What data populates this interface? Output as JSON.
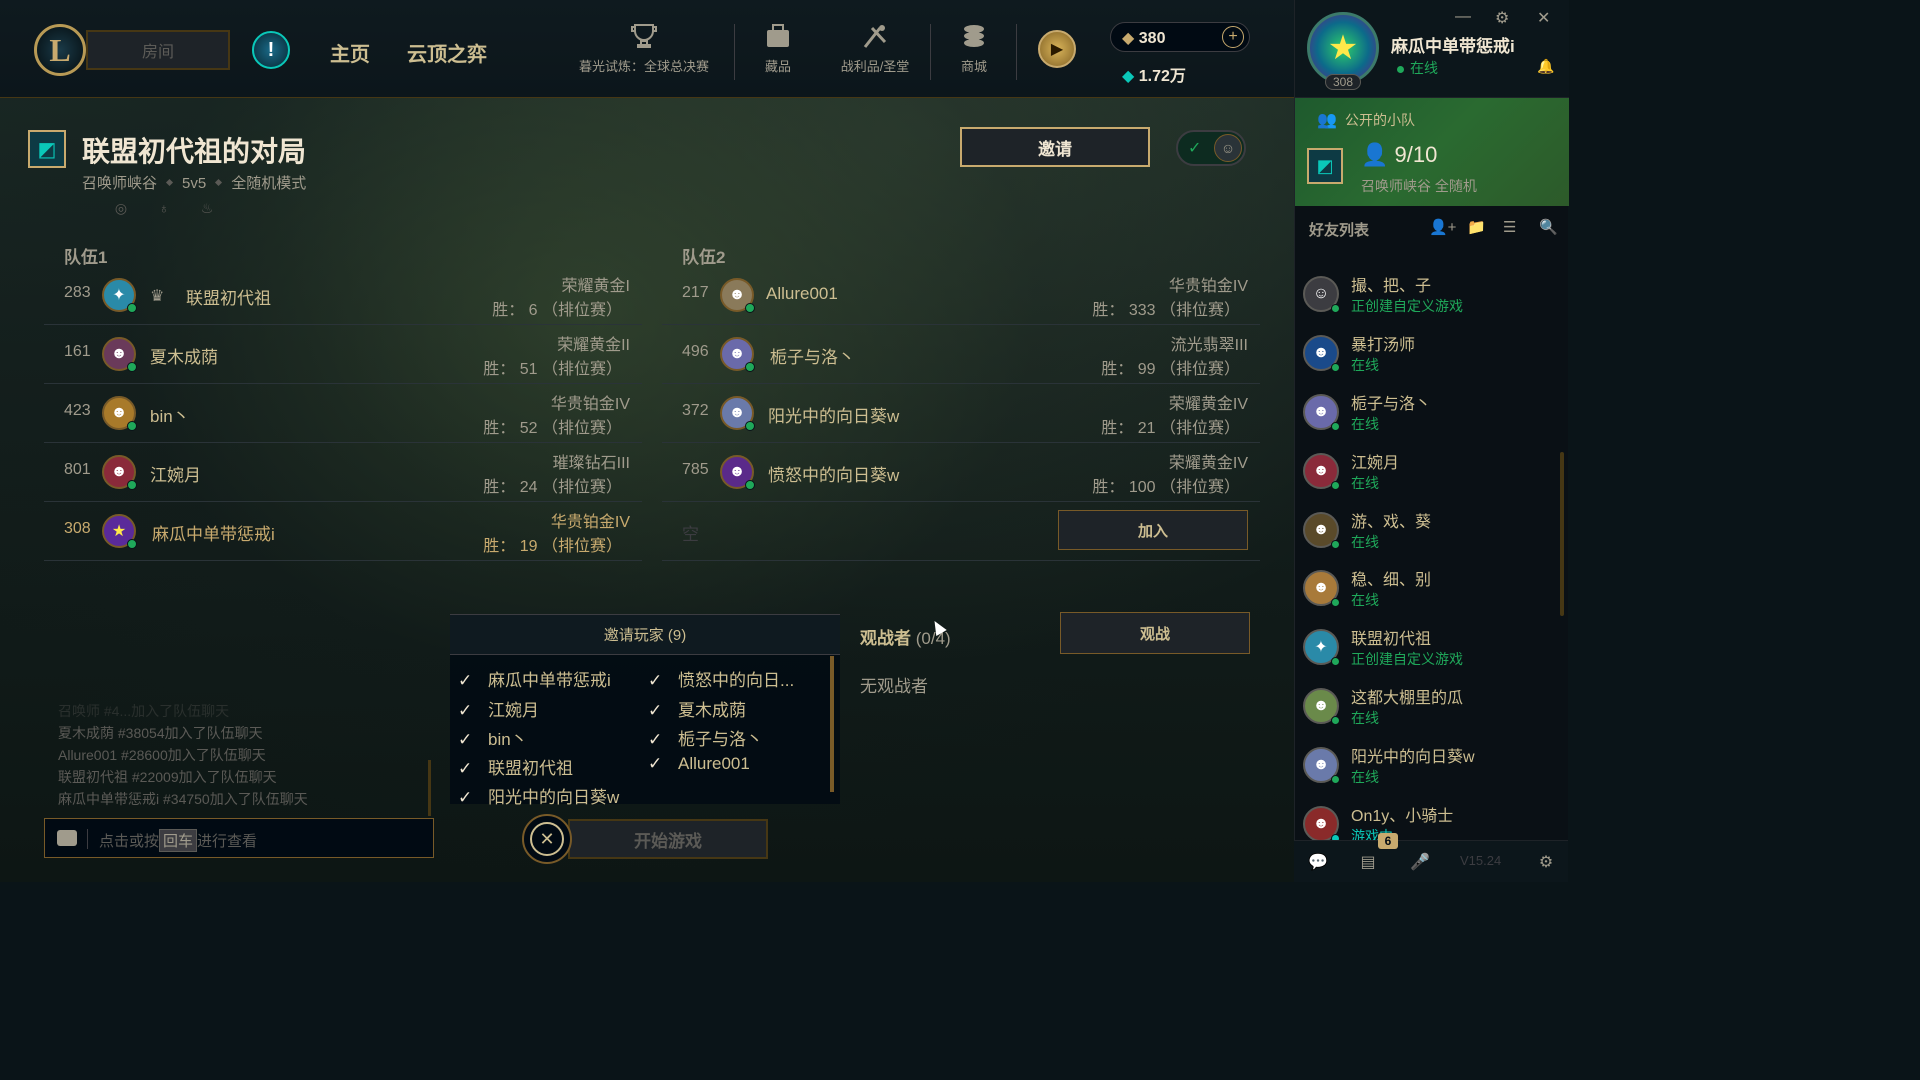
{
  "nav": {
    "room": "房间",
    "home": "主页",
    "tft": "云顶之弈",
    "items": [
      {
        "label": "暮光试炼：全球总决赛",
        "icon": "trophy-icon"
      },
      {
        "label": "藏品",
        "icon": "collection-icon"
      },
      {
        "label": "战利品/圣堂",
        "icon": "loot-icon"
      },
      {
        "label": "商城",
        "icon": "store-icon"
      }
    ],
    "rp": "380",
    "blue_essence": "1.72万"
  },
  "lobby": {
    "title": "联盟初代祖的对局",
    "map": "召唤师峡谷",
    "size": "5v5",
    "mode": "全随机模式",
    "invite_label": "邀请"
  },
  "teams": [
    {
      "label": "队伍1",
      "members": [
        {
          "level": "283",
          "name": "联盟初代祖",
          "rank": "荣耀黄金I",
          "wins": "胜：  6  （排位赛）",
          "owner": true,
          "avatar_color": "#2a8aa8",
          "me": false
        },
        {
          "level": "161",
          "name": "夏木成荫",
          "rank": "荣耀黄金II",
          "wins": "胜：  51  （排位赛）",
          "owner": false,
          "avatar_color": "#6a3a5a",
          "me": false
        },
        {
          "level": "423",
          "name": "bin丶",
          "rank": "华贵铂金IV",
          "wins": "胜：  52  （排位赛）",
          "owner": false,
          "avatar_color": "#a87a2a",
          "me": false
        },
        {
          "level": "801",
          "name": "江婉月",
          "rank": "璀璨钻石III",
          "wins": "胜：  24  （排位赛）",
          "owner": false,
          "avatar_color": "#8a2a3a",
          "me": false
        },
        {
          "level": "308",
          "name": "麻瓜中单带惩戒i",
          "rank": "华贵铂金IV",
          "wins": "胜：  19  （排位赛）",
          "owner": false,
          "avatar_color": "#5a2a9a",
          "me": true
        }
      ]
    },
    {
      "label": "队伍2",
      "members": [
        {
          "level": "217",
          "name": "Allure001",
          "rank": "华贵铂金IV",
          "wins": "胜：  333  （排位赛）",
          "avatar_color": "#8a7a5a"
        },
        {
          "level": "496",
          "name": "栀子与洛丶",
          "rank": "流光翡翠III",
          "wins": "胜：  99  （排位赛）",
          "avatar_color": "#6a6aaa"
        },
        {
          "level": "372",
          "name": "阳光中的向日葵w",
          "rank": "荣耀黄金IV",
          "wins": "胜：  21  （排位赛）",
          "avatar_color": "#6a7aaa"
        },
        {
          "level": "785",
          "name": "愤怒中的向日葵w",
          "rank": "荣耀黄金IV",
          "wins": "胜：  100  （排位赛）",
          "avatar_color": "#5a2a8a"
        }
      ],
      "empty_label": "空",
      "join_label": "加入"
    }
  ],
  "chat": {
    "faded_line": "召唤师 #4...加入了队伍聊天",
    "lines": [
      "夏木成荫 #38054加入了队伍聊天",
      "Allure001 #28600加入了队伍聊天",
      "联盟初代祖 #22009加入了队伍聊天",
      "麻瓜中单带惩戒i #34750加入了队伍聊天"
    ],
    "placeholder_pre": "点击或按",
    "placeholder_key": "回车",
    "placeholder_post": "进行查看"
  },
  "invite_panel": {
    "title": "邀请玩家 (9)",
    "left": [
      "麻瓜中单带惩戒i",
      "江婉月",
      "bin丶",
      "联盟初代祖",
      "阳光中的向日葵w"
    ],
    "right": [
      "愤怒中的向日...",
      "夏木成荫",
      "栀子与洛丶",
      "Allure001"
    ]
  },
  "start_label": "开始游戏",
  "spectators": {
    "label": "观战者",
    "count": "(0/4)",
    "button": "观战",
    "none": "无观战者"
  },
  "profile": {
    "name": "麻瓜中单带惩戒i",
    "status": "在线",
    "level": "308"
  },
  "party": {
    "header": "公开的小队",
    "count": "9/10",
    "mode": "召唤师峡谷 全随机"
  },
  "friends": {
    "header": "好友列表",
    "list": [
      {
        "name": "撮、把、子",
        "status": "正创建自定义游戏",
        "color": "#3c3c41",
        "ingame": false
      },
      {
        "name": "暴打汤师",
        "status": "在线",
        "color": "#1a4a8a",
        "ingame": false
      },
      {
        "name": "栀子与洛丶",
        "status": "在线",
        "color": "#6a6aaa",
        "ingame": false
      },
      {
        "name": "江婉月",
        "status": "在线",
        "color": "#8a2a3a",
        "ingame": false
      },
      {
        "name": "游、戏、葵",
        "status": "在线",
        "color": "#5a4a2a",
        "ingame": false
      },
      {
        "name": "稳、细、别",
        "status": "在线",
        "color": "#a87a3a",
        "ingame": false
      },
      {
        "name": "联盟初代祖",
        "status": "正创建自定义游戏",
        "color": "#2a8aa8",
        "ingame": false
      },
      {
        "name": "这都大棚里的瓜",
        "status": "在线",
        "color": "#6a8a4a",
        "ingame": false
      },
      {
        "name": "阳光中的向日葵w",
        "status": "在线",
        "color": "#6a7aaa",
        "ingame": false
      },
      {
        "name": "On1y、小骑士",
        "status": "游戏中",
        "color": "#8a2a2a",
        "ingame": true
      }
    ]
  },
  "bottom": {
    "badge": "6",
    "version": "V15.24"
  }
}
